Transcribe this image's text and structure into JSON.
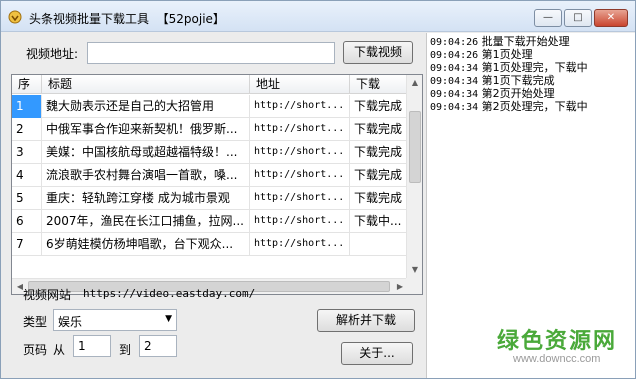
{
  "window": {
    "title": "头条视频批量下载工具  【52pojie】",
    "minimize": "—",
    "maximize": "□",
    "close": "✕"
  },
  "url_row": {
    "label": "视频地址:",
    "value": "",
    "download_button": "下载视频"
  },
  "table": {
    "columns": [
      "序",
      "标题",
      "地址",
      "下载"
    ],
    "rows": [
      {
        "num": "1",
        "title": "魏大勋表示还是自己的大招管用",
        "url": "http://short...",
        "status": "下载完成",
        "selected": true
      },
      {
        "num": "2",
        "title": "中俄军事合作迎来新契机！俄罗斯...",
        "url": "http://short...",
        "status": "下载完成",
        "selected": false
      },
      {
        "num": "3",
        "title": "美媒：中国核航母或超越福特级！...",
        "url": "http://short...",
        "status": "下载完成",
        "selected": false
      },
      {
        "num": "4",
        "title": "流浪歌手农村舞台演唱一首歌，嗓...",
        "url": "http://short...",
        "status": "下载完成",
        "selected": false
      },
      {
        "num": "5",
        "title": "重庆：轻轨跨江穿楼 成为城市景观",
        "url": "http://short...",
        "status": "下载完成",
        "selected": false
      },
      {
        "num": "6",
        "title": "2007年，渔民在长江口捕鱼，拉网...",
        "url": "http://short...",
        "status": "下载中...",
        "selected": false
      },
      {
        "num": "7",
        "title": "6岁萌娃模仿杨坤唱歌，台下观众...",
        "url": "http://short...",
        "status": "",
        "selected": false
      }
    ]
  },
  "site": {
    "label": "视频网站",
    "url": "https://video.eastday.com/"
  },
  "type": {
    "label": "类型",
    "selected": "娱乐"
  },
  "parse_button": "解析并下载",
  "pages": {
    "label": "页码",
    "from_label": "从",
    "from_value": "1",
    "to_label": "到",
    "to_value": "2"
  },
  "about_button": "关于...",
  "log": [
    {
      "time": "09:04:26",
      "msg": "批量下载开始处理"
    },
    {
      "time": "09:04:26",
      "msg": "第1页处理"
    },
    {
      "time": "09:04:34",
      "msg": "第1页处理完，下载中"
    },
    {
      "time": "09:04:34",
      "msg": "第1页下载完成"
    },
    {
      "time": "09:04:34",
      "msg": "第2页开始处理"
    },
    {
      "time": "09:04:34",
      "msg": "第2页处理完，下载中"
    }
  ],
  "watermark": {
    "brand": "绿色资源网",
    "site": "www.downcc.com"
  },
  "colors": {
    "selection": "#3399ff",
    "watermark": "#4aa93a"
  },
  "icons": {
    "app": "app-icon",
    "dropdown": "chevron-down-icon"
  }
}
